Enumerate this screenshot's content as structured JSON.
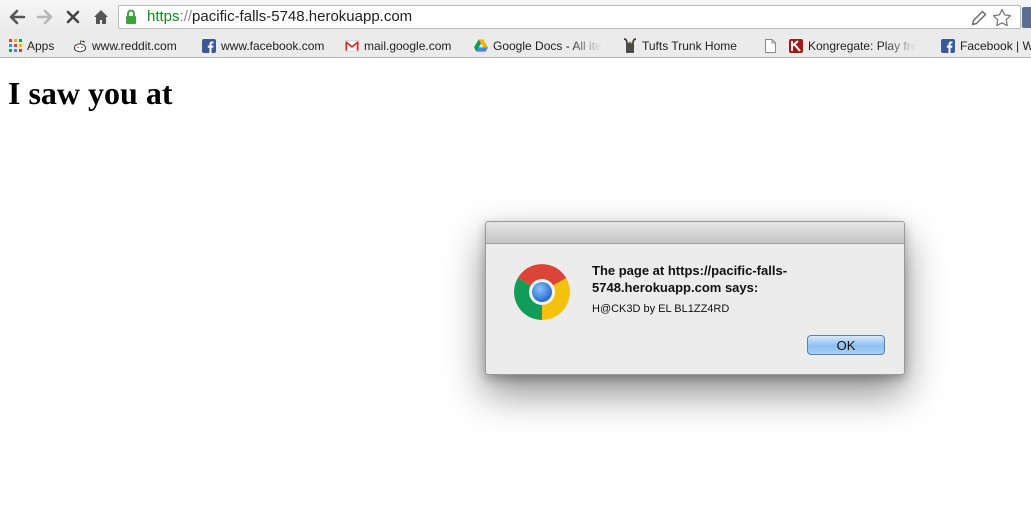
{
  "toolbar": {
    "url_scheme": "https",
    "url_separator": "://",
    "url_host": "pacific-falls-5748.herokuapp.com"
  },
  "bookmarks": [
    {
      "label": "Apps",
      "icon": "apps-grid-icon"
    },
    {
      "label": "www.reddit.com",
      "icon": "reddit-icon"
    },
    {
      "label": "www.facebook.com",
      "icon": "facebook-icon"
    },
    {
      "label": "mail.google.com",
      "icon": "gmail-icon"
    },
    {
      "label": "Google Docs - All ite",
      "icon": "google-drive-icon"
    },
    {
      "label": "Tufts Trunk Home",
      "icon": "tufts-icon"
    },
    {
      "label": "",
      "icon": "page-icon"
    },
    {
      "label": "Kongregate: Play fre",
      "icon": "kongregate-icon"
    },
    {
      "label": "Facebook | W",
      "icon": "facebook-icon"
    }
  ],
  "page": {
    "heading": "I saw you at"
  },
  "dialog": {
    "title": "The page at https://pacific-falls-5748.herokuapp.com says:",
    "message": "H@CK3D by EL BL1ZZ4RD",
    "ok_label": "OK"
  },
  "colors": {
    "secure_scheme": "#0a8c22",
    "facebook": "#3b5998",
    "ok_button": "#8fbff0"
  }
}
